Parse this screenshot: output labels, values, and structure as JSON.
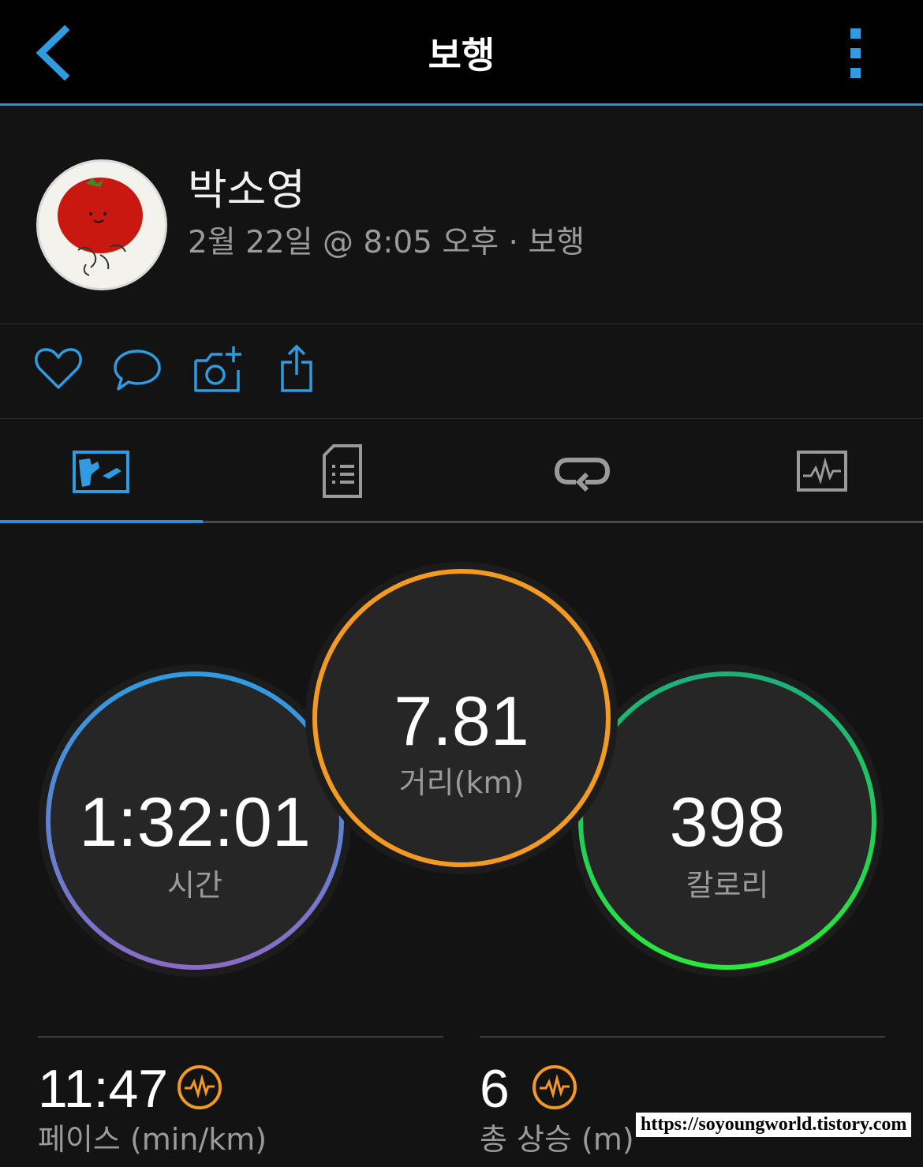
{
  "header": {
    "title": "보행",
    "back_icon": "chevron-left-icon",
    "menu_icon": "kebab-menu-icon",
    "accent": "#2f8fd6"
  },
  "profile": {
    "name": "박소영",
    "meta": "2월 22일 @ 8:05 오후 · 보행"
  },
  "actions": [
    "heart-icon",
    "comment-icon",
    "add-photo-icon",
    "share-icon"
  ],
  "tabs": [
    {
      "icon": "map-icon",
      "selected": true
    },
    {
      "icon": "details-icon",
      "selected": false
    },
    {
      "icon": "laps-icon",
      "selected": false
    },
    {
      "icon": "chart-icon",
      "selected": false
    }
  ],
  "stats": {
    "time": {
      "value": "1:32:01",
      "label": "시간"
    },
    "distance": {
      "value": "7.81",
      "label": "거리(km)"
    },
    "calories": {
      "value": "398",
      "label": "칼로리"
    }
  },
  "summary": {
    "pace": {
      "value": "11:47",
      "label": "페이스 (min/km)",
      "icon": "activity-wave-icon"
    },
    "ascent": {
      "value": "6",
      "label": "총 상승 (m)",
      "icon": "activity-wave-icon"
    }
  },
  "watermark": "https://soyoungworld.tistory.com",
  "colors": {
    "time_ring": [
      "#2f9be0",
      "#8a6cc6"
    ],
    "distance_ring": "#f39a22",
    "calories_ring": [
      "#1bb07a",
      "#29e83b"
    ]
  }
}
